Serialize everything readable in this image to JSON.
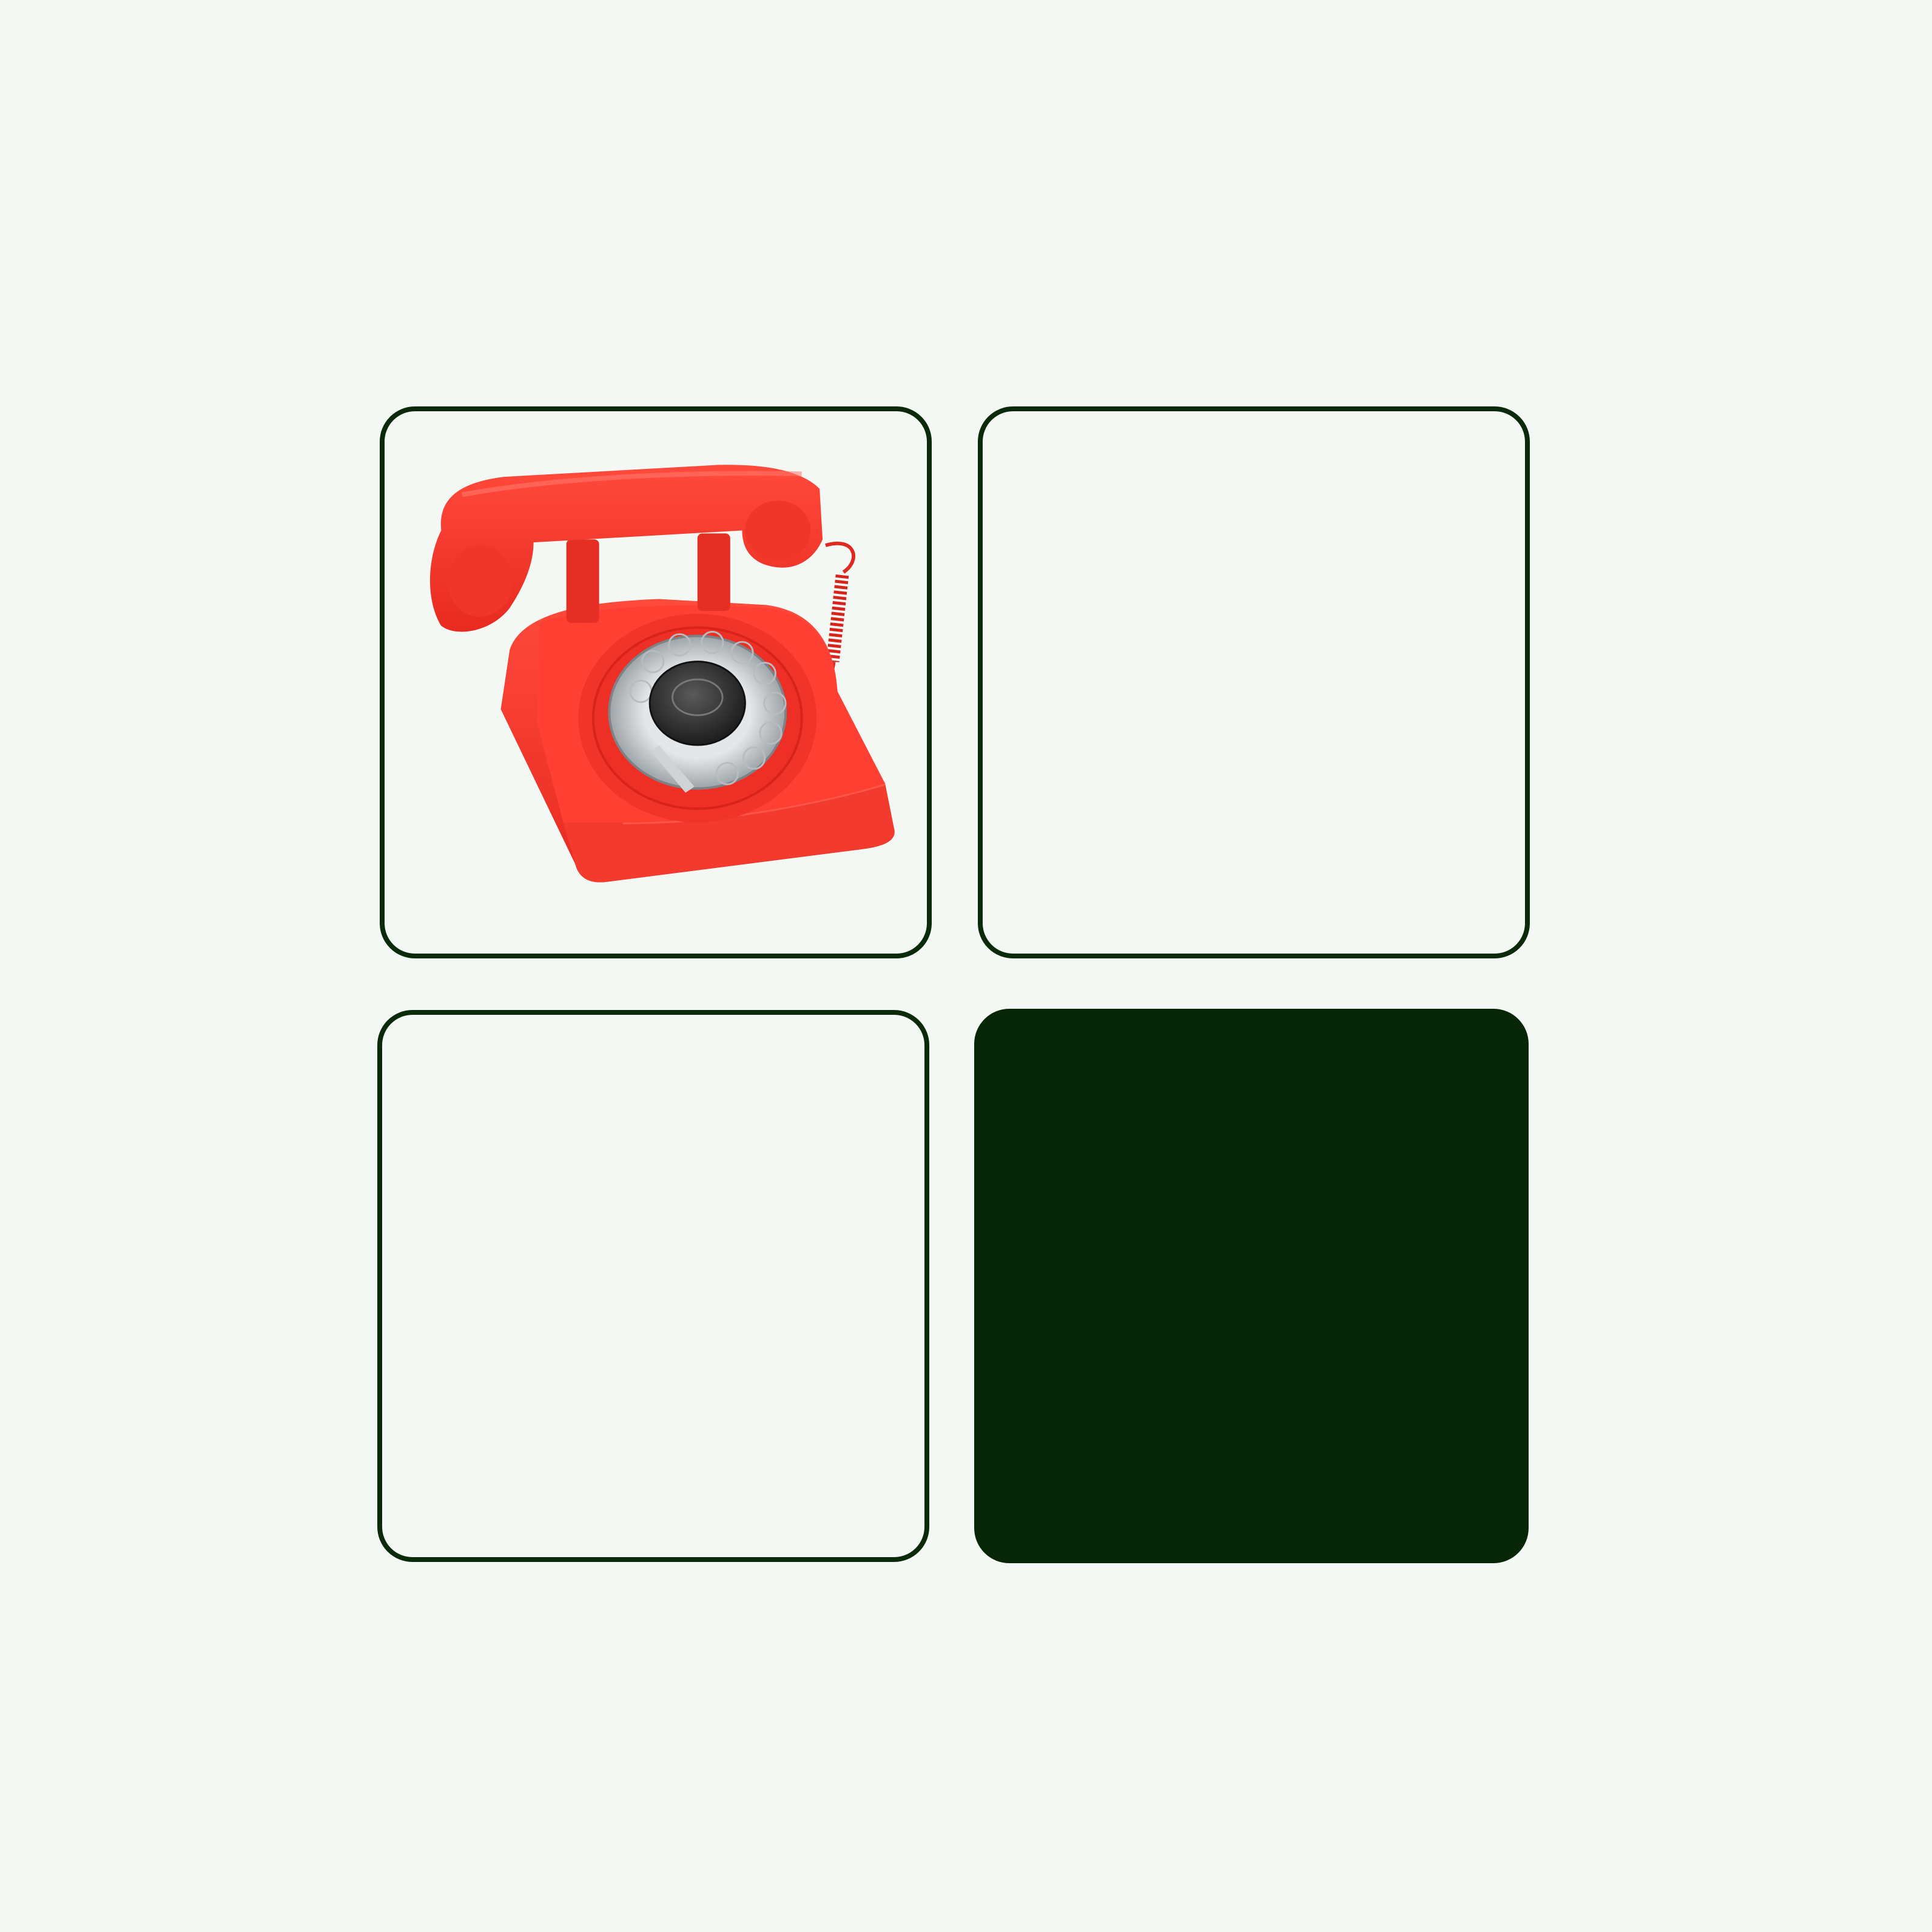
{
  "colors": {
    "background": "#f4f8f4",
    "tile_border": "#0b2a0b",
    "tile_filled": "#072607",
    "phone_red": "#f0342a"
  },
  "tiles": [
    {
      "state": "image",
      "image": "red-rotary-telephone"
    },
    {
      "state": "empty"
    },
    {
      "state": "empty"
    },
    {
      "state": "filled"
    }
  ]
}
